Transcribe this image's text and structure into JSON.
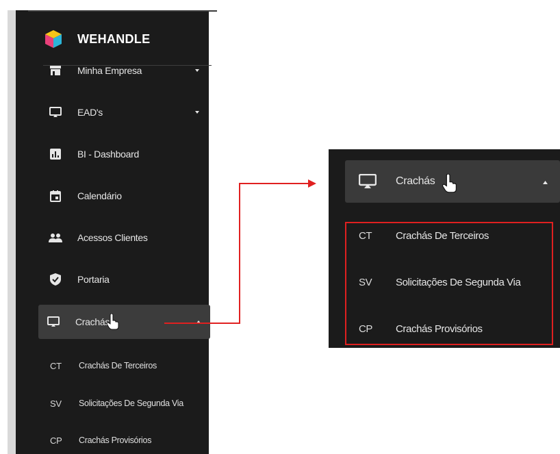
{
  "brand": {
    "name": "WEHANDLE"
  },
  "sidebar": {
    "items": [
      {
        "label": "Minha Empresa",
        "icon": "store-icon",
        "has_caret": true
      },
      {
        "label": "EAD's",
        "icon": "monitor-icon",
        "has_caret": true
      },
      {
        "label": "BI - Dashboard",
        "icon": "chart-icon",
        "has_caret": false
      },
      {
        "label": "Calendário",
        "icon": "calendar-icon",
        "has_caret": false
      },
      {
        "label": "Acessos Clientes",
        "icon": "people-icon",
        "has_caret": false
      },
      {
        "label": "Portaria",
        "icon": "shield-icon",
        "has_caret": false
      },
      {
        "label": "Crachás",
        "icon": "monitor-icon",
        "has_caret": true,
        "active": true
      }
    ],
    "subitems": [
      {
        "abbr": "CT",
        "label": "Crachás De Terceiros"
      },
      {
        "abbr": "SV",
        "label": "Solicitações De Segunda Via"
      },
      {
        "abbr": "CP",
        "label": "Crachás Provisórios"
      }
    ]
  },
  "zoom": {
    "header": {
      "label": "Crachás",
      "icon": "monitor-icon"
    },
    "subitems": [
      {
        "abbr": "CT",
        "label": "Crachás De Terceiros"
      },
      {
        "abbr": "SV",
        "label": "Solicitações De Segunda Via"
      },
      {
        "abbr": "CP",
        "label": "Crachás Provisórios"
      }
    ]
  },
  "colors": {
    "sidebar_bg": "#1b1b1b",
    "active_bg": "#3c3c3c",
    "highlight": "#e02020",
    "text": "#e6e6e6"
  }
}
